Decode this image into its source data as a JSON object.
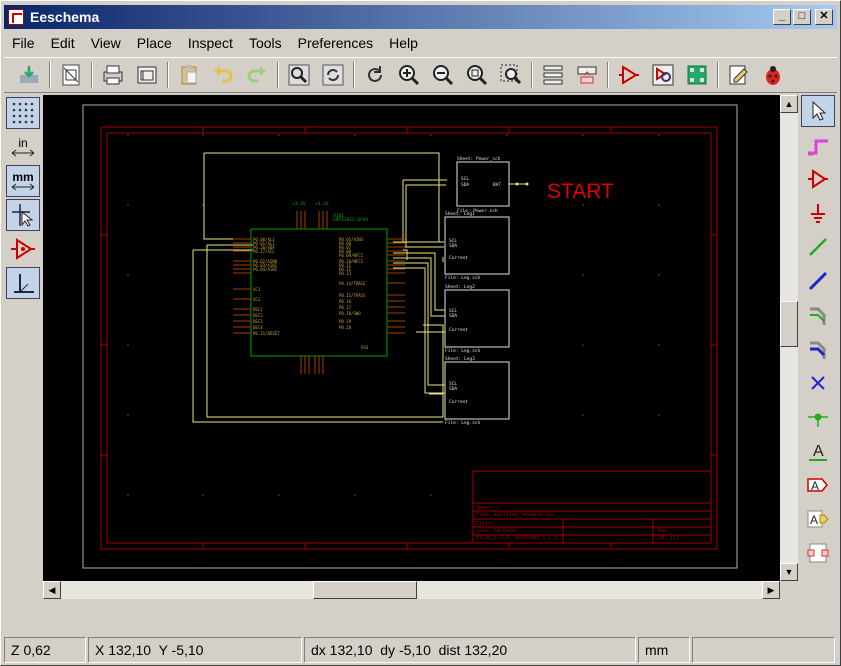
{
  "window": {
    "title": "Eeschema"
  },
  "menu": [
    "File",
    "Edit",
    "View",
    "Place",
    "Inspect",
    "Tools",
    "Preferences",
    "Help"
  ],
  "toolbar": [
    "load-icon",
    "page-settings-icon",
    "print-icon",
    "plot-icon",
    "paste-icon",
    "undo-icon",
    "redo-icon",
    "find-icon",
    "find-replace-icon",
    "refresh-icon",
    "zoom-in-icon",
    "zoom-out-icon",
    "zoom-fit-icon",
    "zoom-selection-icon",
    "hierarchy-icon",
    "leave-sheet-icon",
    "library-editor-icon",
    "library-browser-icon",
    "footprint-editor-icon",
    "annotate-icon",
    "erc-icon"
  ],
  "left_toolbar": {
    "units_in": "in",
    "units_mm": "mm"
  },
  "schematic": {
    "annotation": "START",
    "colors": {
      "border": "#a00000",
      "wire": "#ffff66",
      "component_body": "#00a000",
      "text_red": "#e00000"
    },
    "main_ic": {
      "reference": "U101",
      "value": "nRF52832-QFAA"
    },
    "sheets": [
      {
        "name": "Sheet: Power_sch",
        "file": "File: Power.sch"
      },
      {
        "name": "Sheet: Leg1",
        "file": "File: Leg.sch"
      },
      {
        "name": "Sheet: Leg2",
        "file": "File: Leg.sch"
      },
      {
        "name": "Sheet: Leg3",
        "file": "File: Leg.sch"
      }
    ]
  },
  "status": {
    "zoom": "Z 0,62",
    "xy": "X 132,10  Y -5,10",
    "delta": "dx 132,10  dy -5,10  dist 132,20",
    "units": "mm"
  }
}
